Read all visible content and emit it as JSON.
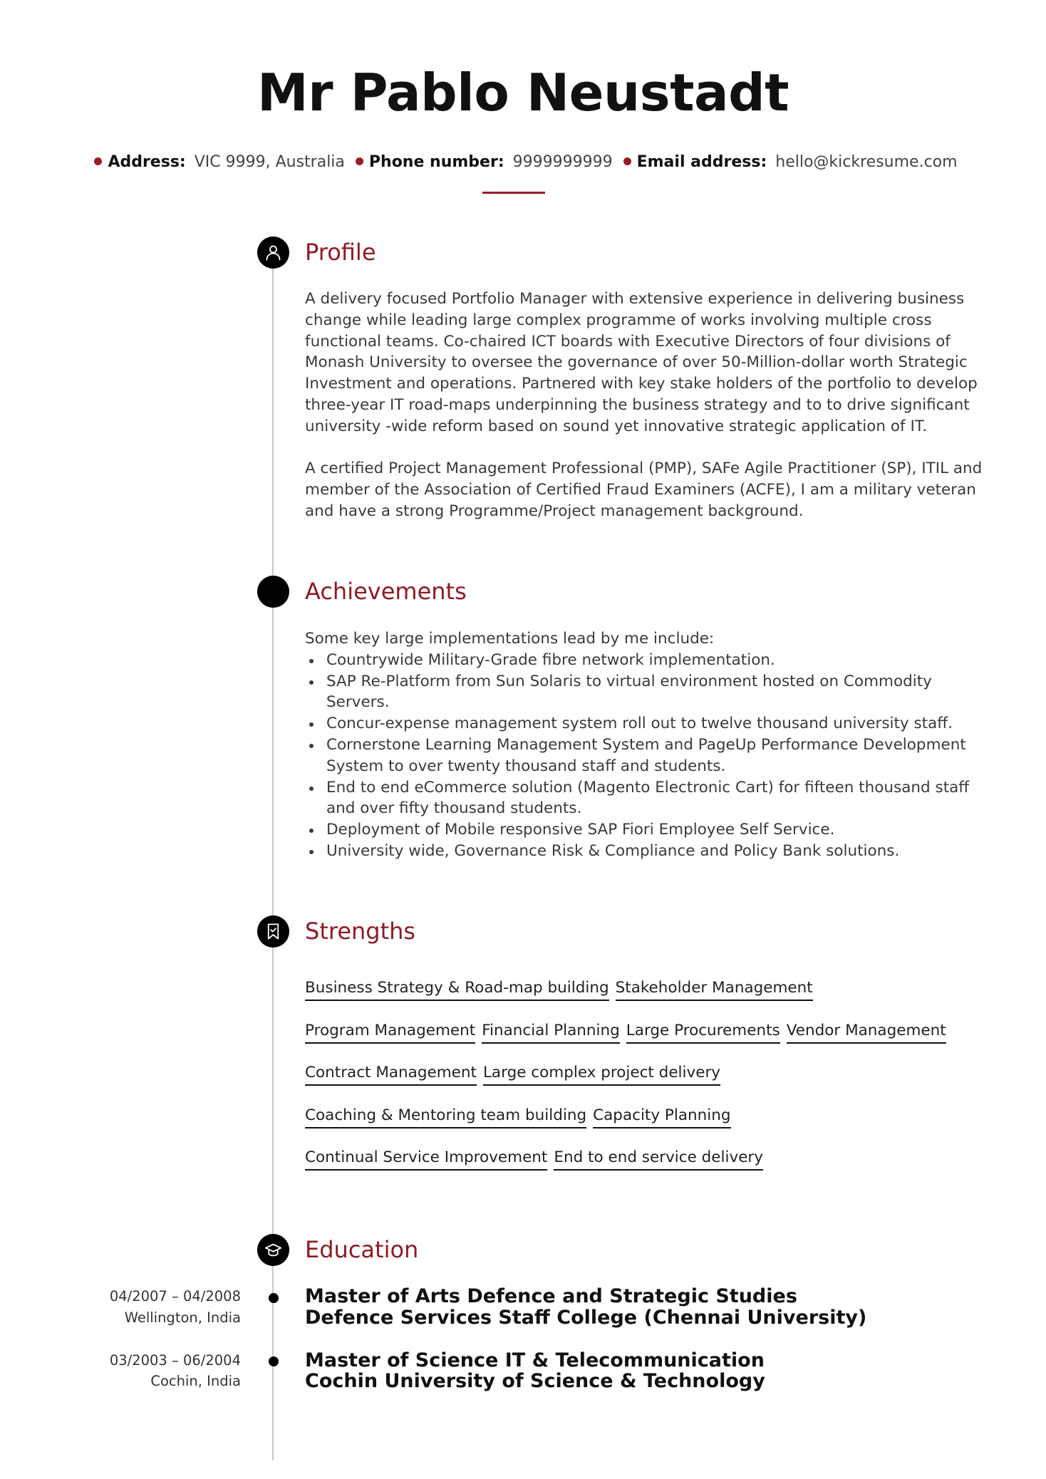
{
  "header": {
    "name": "Mr Pablo Neustadt",
    "contact": [
      {
        "label": "Address:",
        "value": "VIC 9999, Australia"
      },
      {
        "label": "Phone number:",
        "value": "9999999999"
      },
      {
        "label": "Email address:",
        "value": "hello@kickresume.com"
      }
    ]
  },
  "colors": {
    "accent": "#8f1a24",
    "timeline": "#c8c8c8",
    "icon_bg": "#000000"
  },
  "sections": {
    "profile": {
      "title": "Profile",
      "icon": "person-icon",
      "paragraphs": [
        "A delivery focused Portfolio Manager with extensive experience in delivering business change while leading large complex programme of works involving multiple cross functional teams. Co-chaired ICT boards with Executive Directors of four divisions of Monash University to oversee the governance of over 50-Million-dollar worth Strategic Investment and operations. Partnered with key stake holders of the portfolio to develop three-year IT road-maps underpinning the business strategy and to to drive significant university -wide reform based on sound yet innovative strategic application of IT.",
        "A certified Project Management Professional (PMP), SAFe Agile Practitioner (SP), ITIL and member of the Association of Certified Fraud Examiners (ACFE), I am a military veteran and have a strong Programme/Project management background."
      ]
    },
    "achievements": {
      "title": "Achievements",
      "icon": "filled-circle-icon",
      "intro": "Some key large implementations lead by me include:",
      "items": [
        "Countrywide Military-Grade fibre network implementation.",
        "SAP Re-Platform from Sun Solaris to virtual environment hosted on Commodity Servers.",
        "Concur-expense management system roll out to twelve thousand university staff.",
        "Cornerstone Learning Management System and PageUp Performance Development System to over twenty thousand staff and students.",
        "End to end eCommerce solution (Magento Electronic Cart) for fifteen thousand staff and over fifty thousand students.",
        "Deployment of Mobile responsive SAP Fiori Employee Self Service.",
        "University wide, Governance Risk & Compliance and Policy Bank solutions."
      ]
    },
    "strengths": {
      "title": "Strengths",
      "icon": "bookmark-check-icon",
      "rows": [
        [
          "Business Strategy & Road-map building",
          "Stakeholder Management"
        ],
        [
          "Program Management",
          "Financial Planning",
          "Large Procurements",
          "Vendor Management"
        ],
        [
          "Contract Management",
          "Large complex project delivery"
        ],
        [
          "Coaching & Mentoring team building",
          "Capacity Planning"
        ],
        [
          "Continual Service Improvement",
          "End to end service delivery"
        ]
      ]
    },
    "education": {
      "title": "Education",
      "icon": "graduation-cap-icon",
      "entries": [
        {
          "dates": "04/2007 – 04/2008",
          "location": "Wellington, India",
          "degree": "Master of Arts Defence and Strategic Studies",
          "school": "Defence Services Staff College (Chennai University)"
        },
        {
          "dates": "03/2003 – 06/2004",
          "location": "Cochin, India",
          "degree": "Master of Science IT & Telecommunication",
          "school": "Cochin University of Science & Technology"
        }
      ]
    }
  }
}
